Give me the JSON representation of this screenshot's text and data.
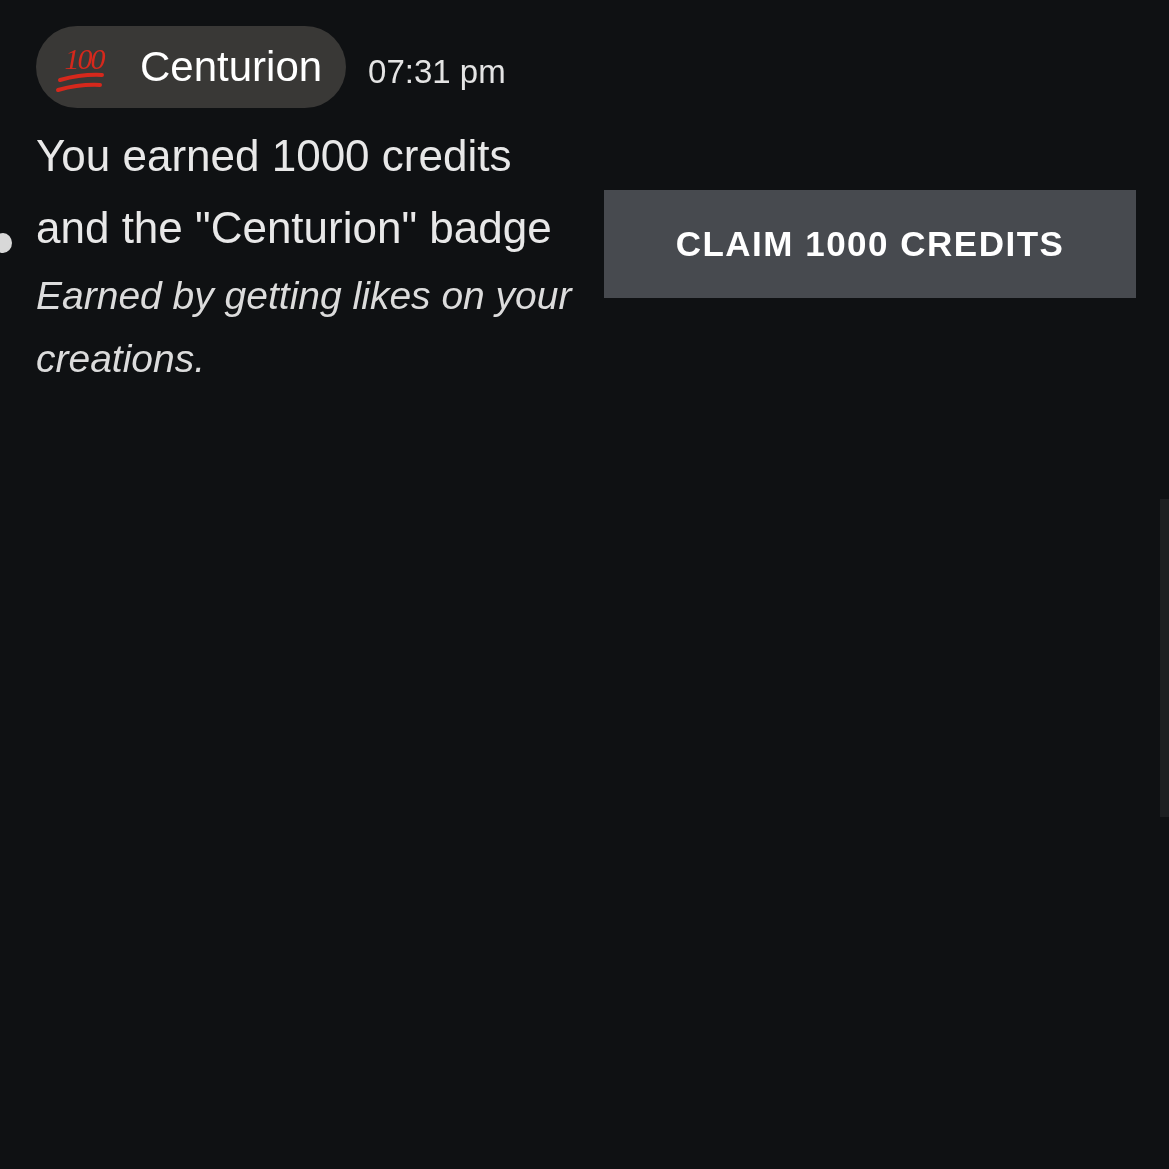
{
  "badge": {
    "emoji_text": "100",
    "name": "Centurion"
  },
  "time": "07:31 pm",
  "message": "You earned 1000 credits and the \"Centurion\" badge",
  "description": "Earned by getting likes on your creations.",
  "claim_button": {
    "label": "CLAIM 1000 CREDITS"
  }
}
